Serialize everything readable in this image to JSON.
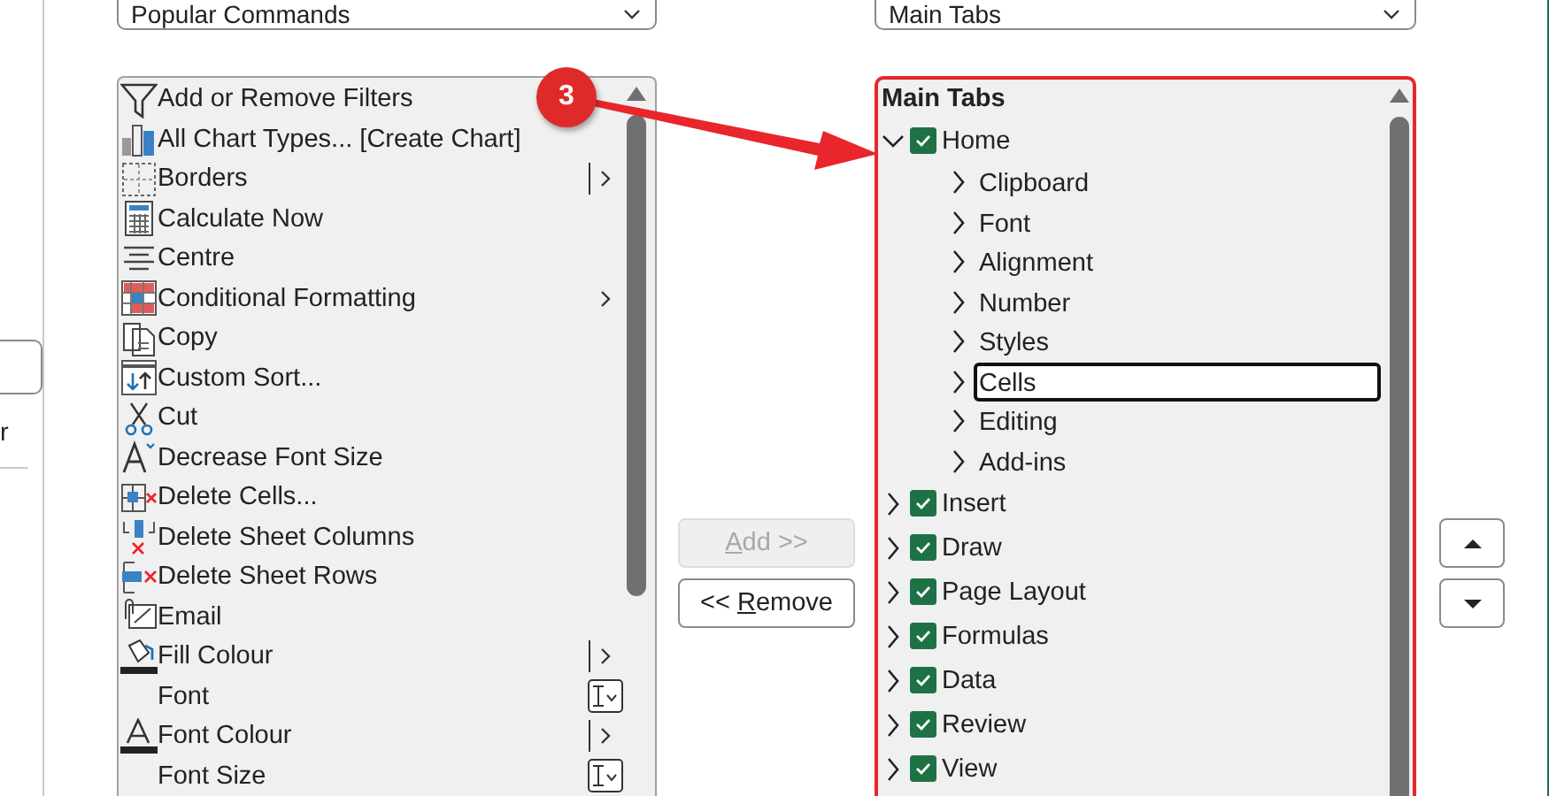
{
  "left_panel": {
    "text": "r"
  },
  "commands_dropdown": {
    "value": "Popular Commands"
  },
  "commands": [
    {
      "label": "Add or Remove Filters",
      "kind": "plain"
    },
    {
      "label": "All Chart Types... [Create Chart]",
      "kind": "plain"
    },
    {
      "label": "Borders",
      "kind": "split"
    },
    {
      "label": "Calculate Now",
      "kind": "plain"
    },
    {
      "label": "Centre",
      "kind": "plain"
    },
    {
      "label": "Conditional Formatting",
      "kind": "submenu"
    },
    {
      "label": "Copy",
      "kind": "plain"
    },
    {
      "label": "Custom Sort...",
      "kind": "plain"
    },
    {
      "label": "Cut",
      "kind": "plain"
    },
    {
      "label": "Decrease Font Size",
      "kind": "plain"
    },
    {
      "label": "Delete Cells...",
      "kind": "plain"
    },
    {
      "label": "Delete Sheet Columns",
      "kind": "plain"
    },
    {
      "label": "Delete Sheet Rows",
      "kind": "plain"
    },
    {
      "label": "Email",
      "kind": "plain"
    },
    {
      "label": "Fill Colour",
      "kind": "split"
    },
    {
      "label": "Font",
      "kind": "picker"
    },
    {
      "label": "Font Colour",
      "kind": "split"
    },
    {
      "label": "Font Size",
      "kind": "picker"
    }
  ],
  "callout": {
    "number": "3"
  },
  "transfer_buttons": [
    {
      "access_key": "A",
      "text_after": "dd >>",
      "disabled": true
    },
    {
      "text_before": "<< ",
      "access_key": "R",
      "text_after": "emove",
      "disabled": false
    }
  ],
  "tabs_dropdown": {
    "value": "Main Tabs"
  },
  "tree": {
    "heading": "Main Tabs",
    "items": [
      {
        "label": "Home",
        "checked": true,
        "expanded": true,
        "children": [
          {
            "label": "Clipboard",
            "expanded": false,
            "selected": false
          },
          {
            "label": "Font",
            "expanded": false,
            "selected": false
          },
          {
            "label": "Alignment",
            "expanded": false,
            "selected": false
          },
          {
            "label": "Number",
            "expanded": false,
            "selected": false
          },
          {
            "label": "Styles",
            "expanded": false,
            "selected": false
          },
          {
            "label": "Cells",
            "expanded": false,
            "selected": true
          },
          {
            "label": "Editing",
            "expanded": false,
            "selected": false
          },
          {
            "label": "Add-ins",
            "expanded": false,
            "selected": false
          }
        ]
      },
      {
        "label": "Insert",
        "checked": true,
        "expanded": false
      },
      {
        "label": "Draw",
        "checked": true,
        "expanded": false
      },
      {
        "label": "Page Layout",
        "checked": true,
        "expanded": false
      },
      {
        "label": "Formulas",
        "checked": true,
        "expanded": false
      },
      {
        "label": "Data",
        "checked": true,
        "expanded": false
      },
      {
        "label": "Review",
        "checked": true,
        "expanded": false
      },
      {
        "label": "View",
        "checked": true,
        "expanded": false
      }
    ]
  },
  "move_buttons": [
    {
      "kind": "up"
    },
    {
      "kind": "down"
    }
  ]
}
